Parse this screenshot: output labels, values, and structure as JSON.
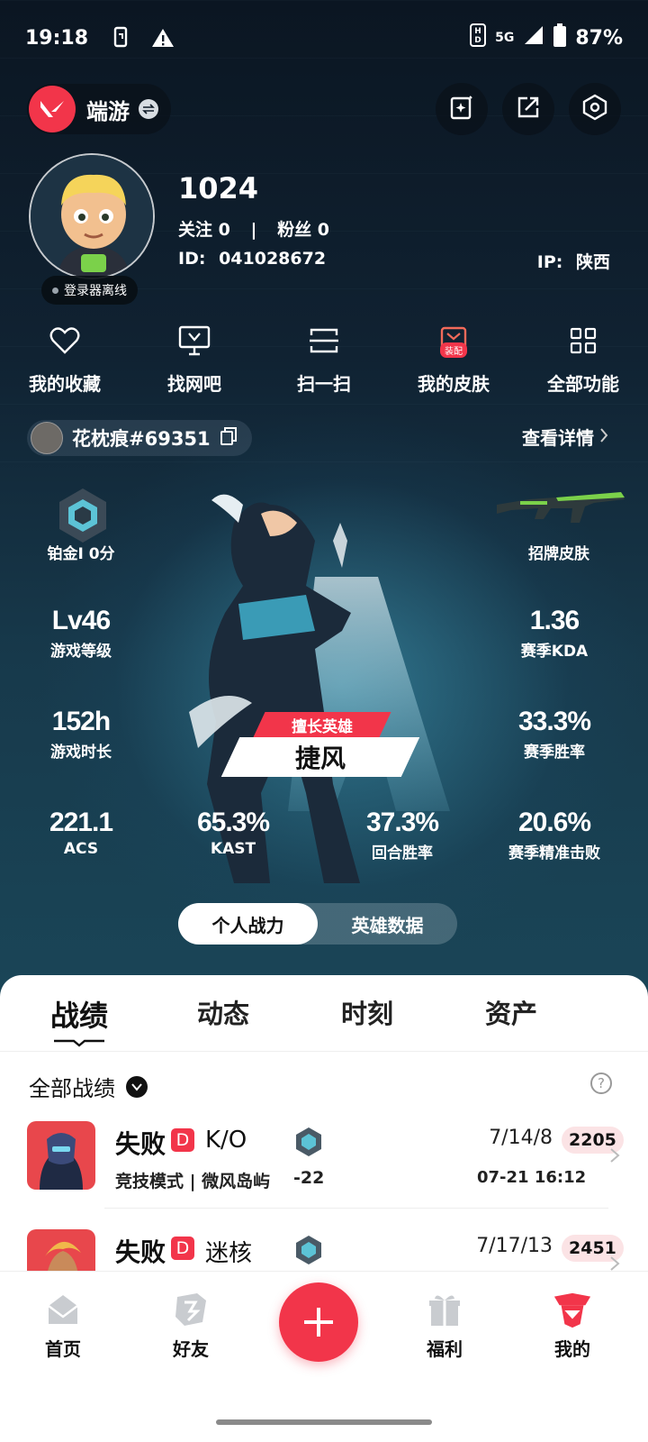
{
  "status_bar": {
    "time": "19:18",
    "network": "5G",
    "battery": "87%"
  },
  "top_bar": {
    "game_name": "端游"
  },
  "profile": {
    "username": "1024",
    "following_label": "关注",
    "following_count": "0",
    "followers_label": "粉丝",
    "followers_count": "0",
    "id_label": "ID:",
    "id_value": "041028672",
    "ip_label": "IP:",
    "ip_value": "陕西",
    "status_badge": "登录器离线"
  },
  "quick_functions": [
    {
      "label": "我的收藏",
      "icon": "heart-icon"
    },
    {
      "label": "找网吧",
      "icon": "monitor-icon"
    },
    {
      "label": "扫一扫",
      "icon": "scan-icon"
    },
    {
      "label": "我的皮肤",
      "icon": "skin-icon",
      "tag": "装配"
    },
    {
      "label": "全部功能",
      "icon": "grid-icon"
    }
  ],
  "riot_id": {
    "name": "花枕痕#69351",
    "view_detail": "查看详情"
  },
  "stats": {
    "rank": "铂金I 0分",
    "signature_skin": "招牌皮肤",
    "level_value": "Lv46",
    "level_label": "游戏等级",
    "kda_value": "1.36",
    "kda_label": "赛季KDA",
    "hours_value": "152h",
    "hours_label": "游戏时长",
    "winrate_value": "33.3%",
    "winrate_label": "赛季胜率",
    "acs_value": "221.1",
    "acs_label": "ACS",
    "kast_value": "65.3%",
    "kast_label": "KAST",
    "round_win_value": "37.3%",
    "round_win_label": "回合胜率",
    "precise_kill_value": "20.6%",
    "precise_kill_label": "赛季精准击败"
  },
  "favorite_hero": {
    "tag": "擅长英雄",
    "name": "捷风"
  },
  "segment": {
    "options": [
      "个人战力",
      "英雄数据"
    ],
    "active": 0
  },
  "tabs": [
    "战绩",
    "动态",
    "时刻",
    "资产"
  ],
  "filter_label": "全部战绩",
  "help_icon": "?",
  "matches": [
    {
      "result": "失败",
      "badge": "D",
      "map": "K/O",
      "mode": "竞技模式 | 微风岛屿",
      "rr": "-22",
      "kda": "7/14/8",
      "acs": "2205",
      "date": "07-21 16:12"
    },
    {
      "result": "失败",
      "badge": "D",
      "map": "迷核",
      "mode": "",
      "rr": "",
      "kda": "7/17/13",
      "acs": "2451",
      "date": ""
    }
  ],
  "bottom_nav": [
    {
      "label": "首页",
      "icon": "home-icon"
    },
    {
      "label": "好友",
      "icon": "friends-icon"
    },
    {
      "label": "福利",
      "icon": "gift-icon"
    },
    {
      "label": "我的",
      "icon": "profile-icon"
    }
  ],
  "colors": {
    "accent": "#f2354a",
    "dark_bg": "#0e1a26",
    "teal_glow": "#3fa5c4"
  }
}
